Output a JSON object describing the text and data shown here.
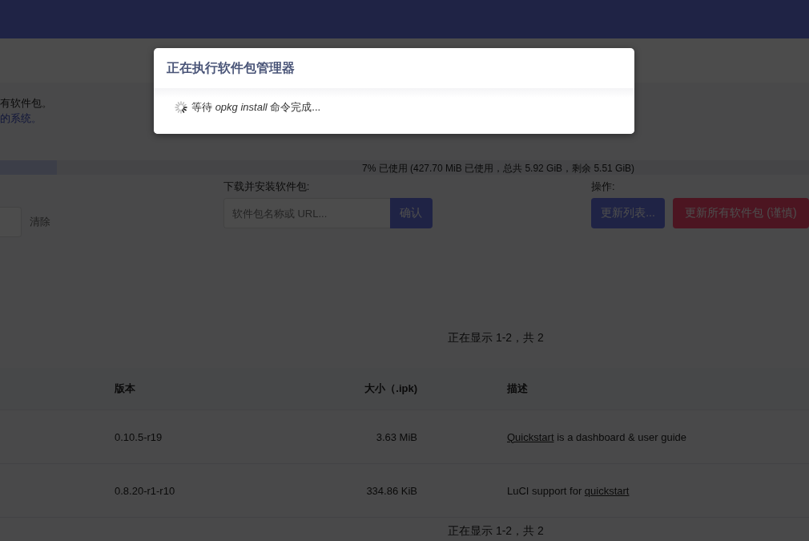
{
  "intro": {
    "text": "有软件包。",
    "link": "的系统。"
  },
  "storage": {
    "level": 0.07,
    "text": "7% 已使用 (427.70 MiB 已使用，总共 5.92 GiB，剩余 5.51 GiB)"
  },
  "filter": {
    "clear_button": "清除"
  },
  "install": {
    "label": "下载并安装软件包:",
    "placeholder": "软件包名称或 URL...",
    "button": "确认"
  },
  "actions": {
    "label": "操作:",
    "buttons": [
      {
        "label": "更新列表...",
        "kind": "primary"
      },
      {
        "label": "更新所有软件包 (谨慎)",
        "kind": "danger"
      }
    ]
  },
  "pager_top": "正在显示 1-2，共 2",
  "table": {
    "columns": [
      "版本",
      "大小（.ipk)",
      "描述"
    ],
    "rows": [
      {
        "version": "0.10.5-r19",
        "size": "3.63 MiB",
        "description": [
          {
            "text": "Quickstart",
            "link": true
          },
          {
            "text": " is a dashboard & user guide",
            "link": false
          }
        ]
      },
      {
        "version": "0.8.20-r1-r10",
        "size": "334.86 KiB",
        "description": [
          {
            "text": "LuCI support for ",
            "link": false
          },
          {
            "text": "quickstart",
            "link": true
          }
        ]
      }
    ]
  },
  "pager_bottom": "正在显示 1-2，共 2",
  "dialog": {
    "title": "正在执行软件包管理器",
    "message": "等待 *opkg install* 命令完成..."
  }
}
